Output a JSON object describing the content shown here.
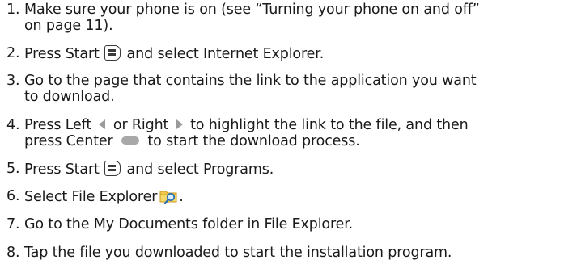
{
  "steps": [
    {
      "number": "1.",
      "line1": "Make sure your phone is on (see “Turning your phone on and off”",
      "line2": "on page 11)."
    },
    {
      "number": "2.",
      "before": "Press Start ",
      "after": " and select Internet Explorer.",
      "icon": "windows-start-key-icon"
    },
    {
      "number": "3.",
      "line1": "Go to the page that contains the link to the application you want",
      "line2": "to download."
    },
    {
      "number": "4.",
      "part_a": "Press Left ",
      "part_b": " or Right ",
      "part_c": " to highlight the link to the file, and then",
      "line2_a": "press Center ",
      "line2_b": " to start the download process.",
      "icons": [
        "nav-left-icon",
        "nav-right-icon",
        "nav-center-icon"
      ]
    },
    {
      "number": "5.",
      "before": "Press Start ",
      "after": " and select Programs.",
      "icon": "windows-start-key-icon"
    },
    {
      "number": "6.",
      "before": "Select File Explorer",
      "after": ".",
      "icon": "file-explorer-icon"
    },
    {
      "number": "7.",
      "text": "Go to the My Documents folder in File Explorer."
    },
    {
      "number": "8.",
      "text": "Tap the file you downloaded to start the installation program."
    }
  ],
  "colors": {
    "text": "#1a1a1a",
    "icon_gray": "#9a9a9a",
    "folder_yellow": "#f2c94c"
  }
}
